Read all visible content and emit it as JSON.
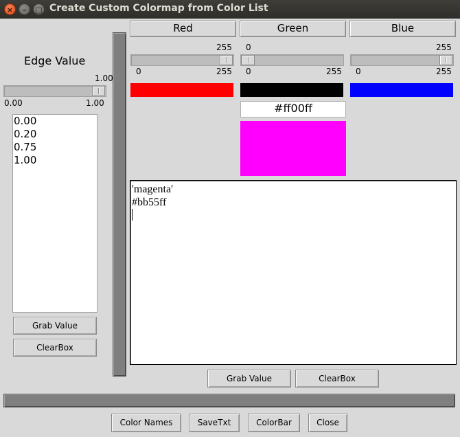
{
  "window": {
    "title": "Create Custom Colormap from Color List",
    "close_glyph": "×",
    "minimize_glyph": "–",
    "maximize_glyph": "□"
  },
  "edge_panel": {
    "title": "Edge Value",
    "scale_value": "1.00",
    "scale_min": "0.00",
    "scale_max": "1.00",
    "scale_fraction": 1.0,
    "values": [
      "0.00",
      "0.20",
      "0.75",
      "1.00"
    ],
    "grab_label": "Grab Value",
    "clear_label": "ClearBox"
  },
  "channels": {
    "red": {
      "label": "Red",
      "value": "255",
      "min": "0",
      "max": "255",
      "fraction": 1.0,
      "swatch": "#ff0000"
    },
    "green": {
      "label": "Green",
      "value": "0",
      "min": "0",
      "max": "255",
      "fraction": 0.0,
      "swatch": "#000000"
    },
    "blue": {
      "label": "Blue",
      "value": "255",
      "min": "0",
      "max": "255",
      "fraction": 1.0,
      "swatch": "#0000ff"
    }
  },
  "mix": {
    "hex": "#ff00ff",
    "color": "#ff00ff"
  },
  "color_list": {
    "lines": [
      "'magenta'",
      "#bb55ff"
    ],
    "grab_label": "Grab Value",
    "clear_label": "ClearBox"
  },
  "bottom_buttons": {
    "color_names": "Color Names",
    "save_txt": "SaveTxt",
    "colorbar": "ColorBar",
    "close": "Close"
  },
  "colors": {
    "window_bg": "#d9d9d9",
    "titlebar": "#3c3b37",
    "close_button": "#e8551f",
    "divider": "#7f7f7f"
  }
}
